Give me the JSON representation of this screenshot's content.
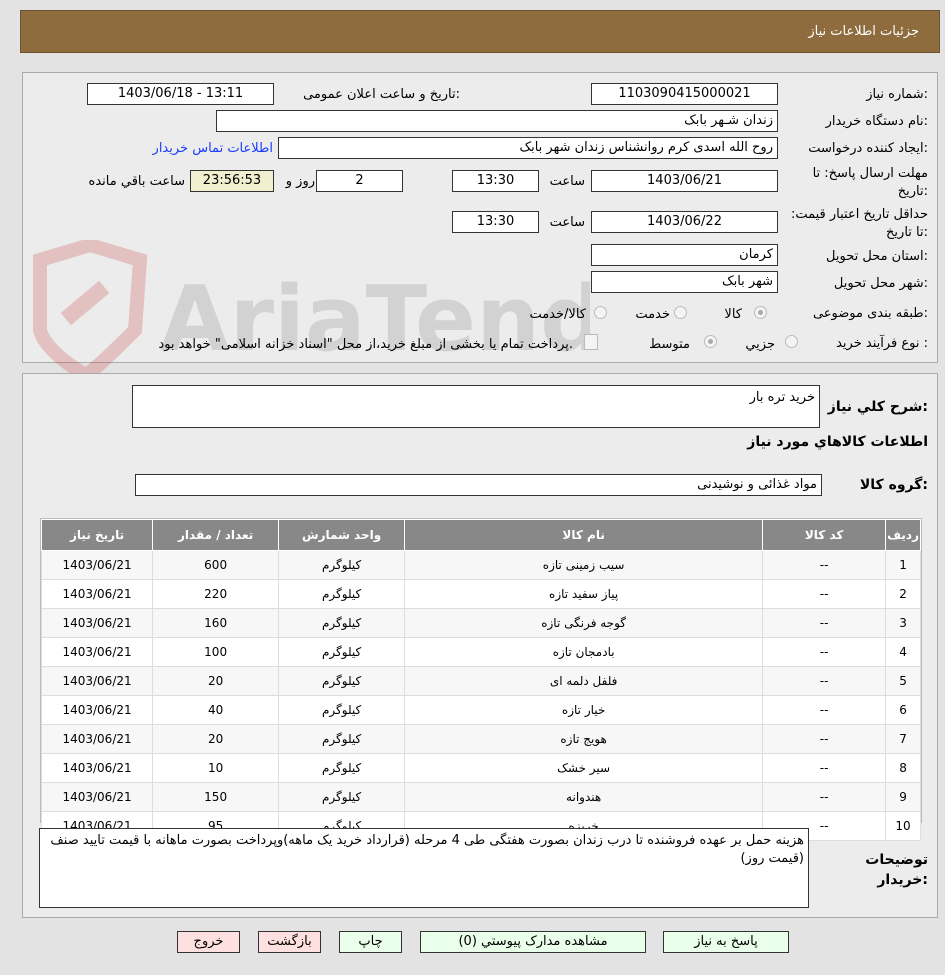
{
  "header": {
    "title": "جزئیات اطلاعات نیاز"
  },
  "form": {
    "need_number_label": "شماره نیاز:",
    "need_number": "1103090415000021",
    "announce_label": "تاریخ و ساعت اعلان عمومی:",
    "announce_value": "1403/06/18 - 13:11",
    "buyer_org_label": "نام دستگاه خریدار:",
    "buyer_org": "زندان شـهر بابک",
    "creator_label": "ایجاد کننده درخواست:",
    "creator": "روح الله اسدی کرم روانشناس زندان شهر بابک",
    "contact_link": "اطلاعات تماس خریدار",
    "deadline_label": "مهلت ارسال پاسخ: تا تاریخ:",
    "deadline_date": "1403/06/21",
    "time_label": "ساعت",
    "deadline_time": "13:30",
    "days": "2",
    "days_label": "روز و",
    "remaining": "23:56:53",
    "remaining_label": "ساعت باقي مانده",
    "validity_label": "حداقل تاریخ اعتبار قیمت: تا تاریخ:",
    "validity_date": "1403/06/22",
    "validity_time": "13:30",
    "province_label": "استان محل تحویل:",
    "province": "کرمان",
    "city_label": "شهر محل تحویل:",
    "city": "شهر بابک",
    "category_label": "طبقه بندی موضوعی:",
    "category_options": [
      "کالا",
      "خدمت",
      "کالا/خدمت"
    ],
    "category_selected": "کالا",
    "process_label": "نوع فرآیند خرید :",
    "process_options": [
      "جزيي",
      "متوسط"
    ],
    "payment_note": "پرداخت تمام یا بخشی از مبلغ خرید،از محل \"اسناد خزانه اسلامی\" خواهد بود."
  },
  "watermark": "AriaTender.neT",
  "details": {
    "summary_label": "شرح کلي نياز:",
    "summary": "خرید تره بار",
    "goods_info_title": "اطلاعات کالاهاي مورد نياز",
    "group_label": "گروه کالا:",
    "group": "مواد غذائی و نوشیدنی",
    "columns": [
      "ردیف",
      "کد کالا",
      "نام کالا",
      "واحد شمارش",
      "تعداد / مقدار",
      "تاریخ نیاز"
    ],
    "rows": [
      [
        "1",
        "--",
        "سیب زمینی تازه",
        "کیلوگرم",
        "600",
        "1403/06/21"
      ],
      [
        "2",
        "--",
        "پیاز سفید تازه",
        "کیلوگرم",
        "220",
        "1403/06/21"
      ],
      [
        "3",
        "--",
        "گوجه فرنگی تازه",
        "کیلوگرم",
        "160",
        "1403/06/21"
      ],
      [
        "4",
        "--",
        "بادمجان تازه",
        "کیلوگرم",
        "100",
        "1403/06/21"
      ],
      [
        "5",
        "--",
        "فلفل دلمه ای",
        "کیلوگرم",
        "20",
        "1403/06/21"
      ],
      [
        "6",
        "--",
        "خیار تازه",
        "کیلوگرم",
        "40",
        "1403/06/21"
      ],
      [
        "7",
        "--",
        "هویج تازه",
        "کیلوگرم",
        "20",
        "1403/06/21"
      ],
      [
        "8",
        "--",
        "سیر خشک",
        "کیلوگرم",
        "10",
        "1403/06/21"
      ],
      [
        "9",
        "--",
        "هندوانه",
        "کیلوگرم",
        "150",
        "1403/06/21"
      ],
      [
        "10",
        "--",
        "خربزه",
        "کیلوگرم",
        "95",
        "1403/06/21"
      ]
    ],
    "buyer_notes_label": "توضیحات خریدار:",
    "buyer_notes": "هزینه حمل بر عهده فروشنده تا درب زندان بصورت هفتگی طی 4 مرحله (قرارداد خرید یک ماهه)وپرداخت بصورت ماهانه با قیمت تایید صنف (قیمت روز)"
  },
  "buttons": {
    "reply": "پاسخ به نیاز",
    "attachments": "مشاهده مدارک پیوستي (0)",
    "print": "چاپ",
    "back": "بازگشت",
    "exit": "خروج"
  },
  "colors": {
    "header": "#8e6c3d",
    "button_green": "#eaffea",
    "button_red": "#ffe0e0",
    "remaining_bg": "#f0f0d0"
  }
}
